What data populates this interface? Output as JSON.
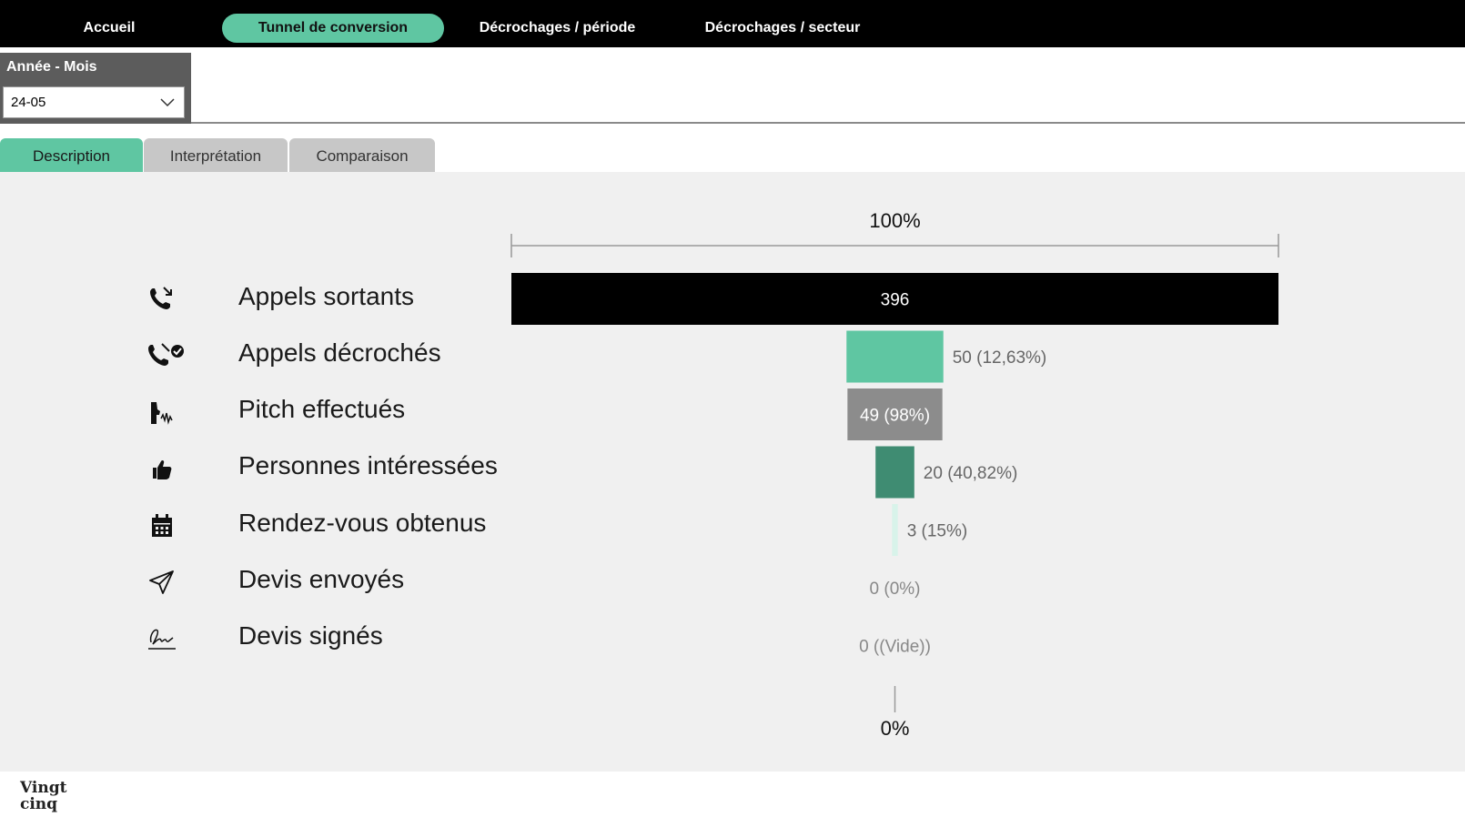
{
  "nav": {
    "items": [
      {
        "label": "Accueil",
        "active": false
      },
      {
        "label": "Tunnel de conversion",
        "active": true
      },
      {
        "label": "Décrochages / période",
        "active": false
      },
      {
        "label": "Décrochages / secteur",
        "active": false
      }
    ]
  },
  "filter": {
    "label": "Année - Mois",
    "value": "24-05"
  },
  "tabs": [
    {
      "label": "Description",
      "active": true
    },
    {
      "label": "Interprétation",
      "active": false
    },
    {
      "label": "Comparaison",
      "active": false
    }
  ],
  "chart_data": {
    "type": "bar",
    "subtype": "funnel",
    "top_label": "100%",
    "bottom_label": "0%",
    "categories": [
      "Appels sortants",
      "Appels décrochés",
      "Pitch effectués",
      "Personnes intéressées",
      "Rendez-vous obtenus",
      "Devis envoyés",
      "Devis signés"
    ],
    "values": [
      396,
      50,
      49,
      20,
      3,
      0,
      0
    ],
    "data_labels": [
      "396",
      "50 (12,63%)",
      "49 (98%)",
      "20 (40,82%)",
      "3 (15%)",
      "0 (0%)",
      "0 ((Vide))"
    ],
    "icons": [
      "phone-outgoing-icon",
      "phone-check-icon",
      "speaking-person-icon",
      "thumbs-up-icon",
      "calendar-icon",
      "send-icon",
      "signature-icon"
    ],
    "colors": [
      "#000000",
      "#5fc6a2",
      "#8c8c8c",
      "#3f8c72",
      "#d8f3ea",
      "#cccccc",
      "#cccccc"
    ],
    "label_inside": [
      true,
      false,
      true,
      false,
      false,
      false,
      false
    ],
    "label_colors": [
      "#ffffff",
      "#666666",
      "#ffffff",
      "#666666",
      "#666666",
      "#888888",
      "#888888"
    ]
  },
  "logo": {
    "text": "Vingt cinq"
  },
  "colors": {
    "accent": "#5fc6a2",
    "nav_bg": "#000000",
    "content_bg": "#f0f0f0"
  }
}
